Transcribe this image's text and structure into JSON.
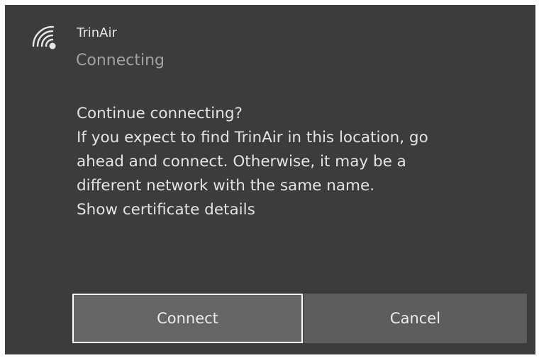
{
  "network": {
    "name": "TrinAir",
    "status": "Connecting",
    "icon": "wifi-secured-icon"
  },
  "message": {
    "heading": "Continue connecting?",
    "lines": [
      "If you expect to find TrinAir in this location, go",
      "ahead and connect. Otherwise, it may be a",
      "different network with the same name."
    ],
    "link": "Show certificate details"
  },
  "buttons": {
    "connect": "Connect",
    "cancel": "Cancel"
  },
  "colors": {
    "panel_background": "#3c3c3c",
    "primary_text": "#e3e3e3",
    "secondary_text": "#a3a3a3",
    "button_background": "#656565",
    "focus_border": "#ffffff"
  }
}
